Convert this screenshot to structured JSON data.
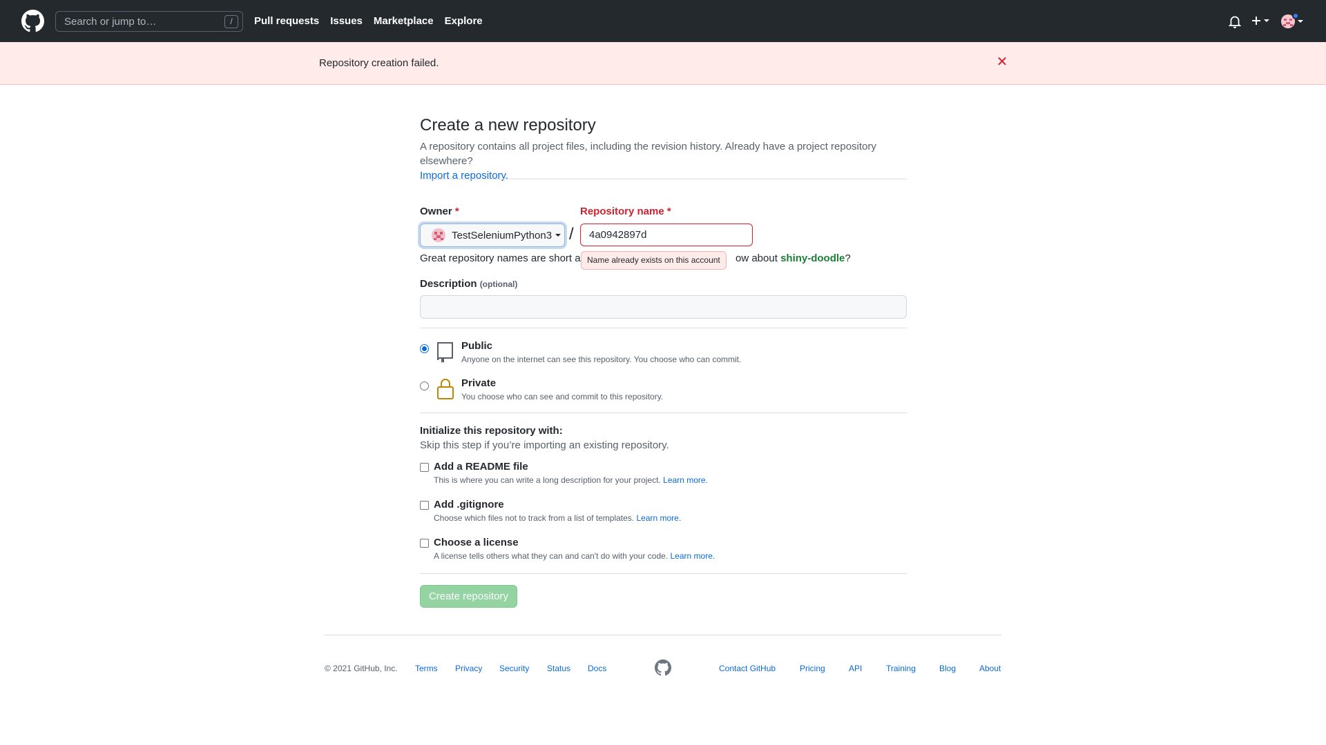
{
  "header": {
    "search_placeholder": "Search or jump to…",
    "search_key": "/",
    "nav": [
      "Pull requests",
      "Issues",
      "Marketplace",
      "Explore"
    ],
    "icons": [
      "github-logo-icon",
      "bell-icon",
      "plus-icon",
      "avatar"
    ]
  },
  "flash": {
    "message": "Repository creation failed.",
    "close": "✕"
  },
  "page": {
    "title": "Create a new repository",
    "subtitle": "A repository contains all project files, including the revision history. Already have a project repository elsewhere?",
    "import_link": "Import a repository."
  },
  "form": {
    "owner_label": "Owner",
    "required_mark": "*",
    "owner_value": "TestSeleniumPython3",
    "repo_label": "Repository name",
    "repo_value": "4a0942897d",
    "hint_prefix": "Great repository names are short and",
    "hint_suffix": "ow about",
    "suggestion": "shiny-doodle",
    "suggestion_end": "?",
    "error_tooltip": "Name already exists on this account",
    "description_label": "Description",
    "description_optional": "(optional)",
    "description_value": ""
  },
  "visibility": {
    "selected": "public",
    "public_title": "Public",
    "public_desc": "Anyone on the internet can see this repository. You choose who can commit.",
    "private_title": "Private",
    "private_desc": "You choose who can see and commit to this repository."
  },
  "init": {
    "title": "Initialize this repository with:",
    "subtitle": "Skip this step if you’re importing an existing repository.",
    "options": [
      {
        "title": "Add a README file",
        "desc": "This is where you can write a long description for your project.",
        "link": "Learn more.",
        "checked": false
      },
      {
        "title": "Add .gitignore",
        "desc": "Choose which files not to track from a list of templates.",
        "link": "Learn more.",
        "checked": false
      },
      {
        "title": "Choose a license",
        "desc": "A license tells others what they can and can't do with your code.",
        "link": "Learn more.",
        "checked": false
      }
    ]
  },
  "submit": {
    "label": "Create repository",
    "enabled": false,
    "color": "#94d3a2"
  },
  "footer": {
    "copyright": "© 2021 GitHub, Inc.",
    "left_links": [
      "Terms",
      "Privacy",
      "Security",
      "Status",
      "Docs"
    ],
    "right_links": [
      "Contact GitHub",
      "Pricing",
      "API",
      "Training",
      "Blog",
      "About"
    ]
  },
  "colors": {
    "header_bg": "#24292e",
    "flash_bg": "#ffebe9",
    "error": "#cf222e",
    "link": "#0969da",
    "success": "#1a7f37"
  }
}
